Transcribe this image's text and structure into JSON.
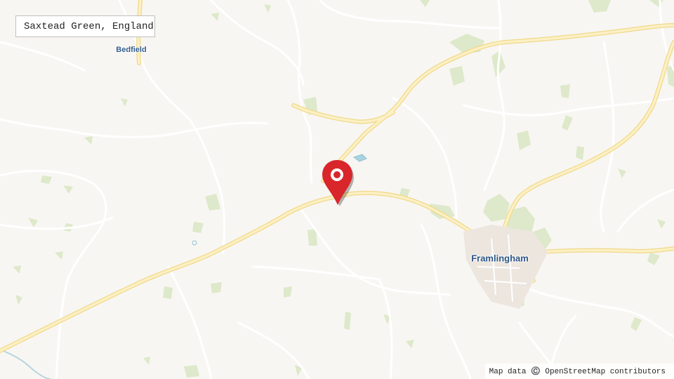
{
  "location_label": "Saxtead Green, England",
  "places": {
    "bedfield": "Bedfield",
    "framlingham": "Framlingham"
  },
  "attribution": "Map data ©️ OpenStreetMap contributors",
  "marker": {
    "icon": "map-pin-icon",
    "color": "#d8262b"
  },
  "colors": {
    "land": "#f8f6f2",
    "major_road": "#fbe7a4",
    "minor_road": "#ffffff",
    "woodland": "#dbe9c8",
    "water": "#aad3df",
    "place_label": "#2d5a8a"
  }
}
